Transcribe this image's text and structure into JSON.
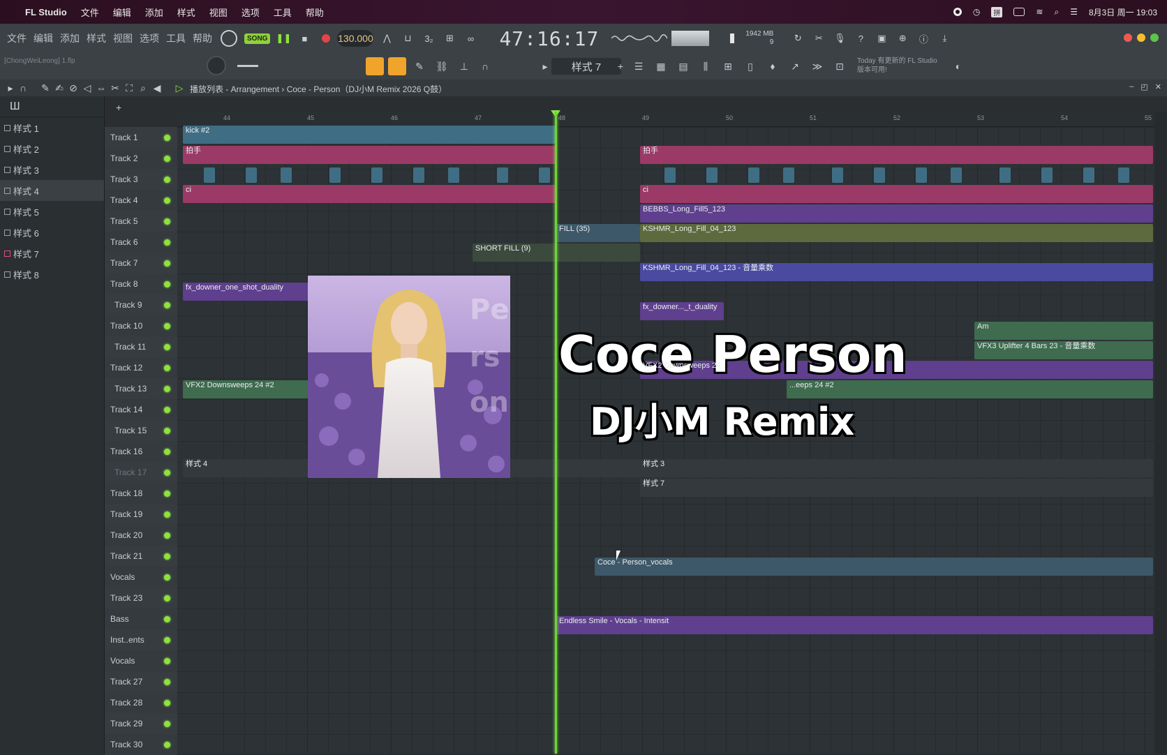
{
  "mac_menu": {
    "app_name": "FL Studio",
    "items": [
      "文件",
      "编辑",
      "添加",
      "样式",
      "视图",
      "选项",
      "工具",
      "帮助"
    ],
    "clock": "8月3日 周一  19:03"
  },
  "toolbar": {
    "menu": [
      "文件",
      "编辑",
      "添加",
      "样式",
      "视图",
      "选项",
      "工具",
      "帮助"
    ],
    "song_label": "SONG",
    "bpm": "130.000",
    "time": "47:16:17",
    "memory": "1942 MB",
    "memory_sub": "9",
    "project_file": "[ChongWeiLeong] 1.flp"
  },
  "toolbar2": {
    "pattern_selector": "样式 7",
    "news_line1": "Today 有更新的 FL Studio",
    "news_line2": "版本可用!"
  },
  "playlist": {
    "title": "播放列表 - Arrangement › Coce - Person（DJ小M Remix 2026 Q鼓）"
  },
  "patterns": [
    "样式 1",
    "样式 2",
    "样式 3",
    "样式 4",
    "样式 5",
    "样式 6",
    "样式 7",
    "样式 8"
  ],
  "ruler_bars": [
    "44",
    "45",
    "46",
    "47",
    "48",
    "49",
    "50",
    "51",
    "52",
    "53",
    "54",
    "55"
  ],
  "tracks": [
    {
      "name": "Track 1"
    },
    {
      "name": "Track 2"
    },
    {
      "name": "Track 3"
    },
    {
      "name": "Track 4"
    },
    {
      "name": "Track 5"
    },
    {
      "name": "Track 6"
    },
    {
      "name": "Track 7"
    },
    {
      "name": "Track 8"
    },
    {
      "name": "Track 9"
    },
    {
      "name": "Track 10"
    },
    {
      "name": "Track 11"
    },
    {
      "name": "Track 12"
    },
    {
      "name": "Track 13"
    },
    {
      "name": "Track 14"
    },
    {
      "name": "Track 15"
    },
    {
      "name": "Track 16"
    },
    {
      "name": "Track 17"
    },
    {
      "name": "Track 18"
    },
    {
      "name": "Track 19"
    },
    {
      "name": "Track 20"
    },
    {
      "name": "Track 21"
    },
    {
      "name": "Vocals"
    },
    {
      "name": "Track 23"
    },
    {
      "name": "Bass"
    },
    {
      "name": "Inst..ents"
    },
    {
      "name": "Vocals"
    },
    {
      "name": "Track 27"
    },
    {
      "name": "Track 28"
    },
    {
      "name": "Track 29"
    },
    {
      "name": "Track 30"
    }
  ],
  "clips": {
    "kick": "kick #2",
    "clap_a": "拍手",
    "clap_b": "拍手",
    "ci_a": "ci",
    "ci_b": "ci",
    "bebbs": "BEBBS_Long_Fill5_123",
    "fill35": "FILL (35)",
    "kshmr_fill": "KSHMR_Long_Fill_04_123",
    "short_fill": "SHORT FILL (9)",
    "kshmr_auto": "KSHMR_Long_Fill_04_123 - 音量乘数",
    "fx_downer": "fx_downer_one_shot_duality",
    "fx_downer_b": "fx_downer..._t_duality",
    "am": "Am",
    "vfx3": "VFX3 Uplifter 4 Bars 23 - 音量乘数",
    "vfx2_24": "VFX2 Downsweeps 24",
    "vfx2_24_2": "VFX2 Downsweeps 24 #2",
    "vfx2_24_2b": "...eeps 24 #2",
    "pattern4": "样式 4",
    "pattern3": "样式 3",
    "pattern7": "样式 7",
    "person_vocals": "Coce - Person_vocals",
    "endless": "Endless Smile - Vocals - Intensit"
  },
  "overlay": {
    "title": "Coce Person",
    "subtitle": "DJ小M Remix"
  },
  "colors": {
    "playhead": "#6ed23a",
    "clip_blue": "#3f6e84",
    "clip_pink": "#9b3a66",
    "clip_purple": "#5f3f8e",
    "clip_violet": "#4a4aa0",
    "clip_olive": "#5c6a3d",
    "clip_green": "#3f6b4f",
    "clip_slate": "#3d5868"
  }
}
